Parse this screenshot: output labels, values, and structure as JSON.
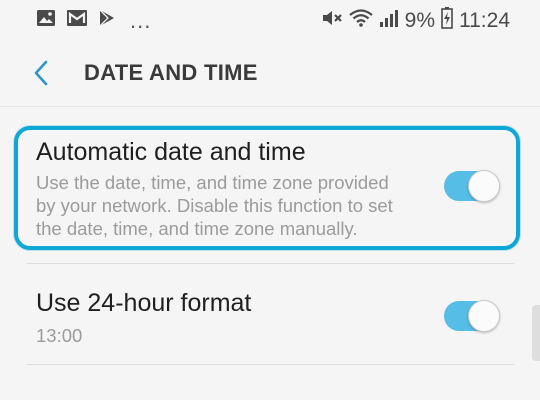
{
  "status_bar": {
    "battery_percent": "9%",
    "time": "11:24",
    "icons": [
      "gallery-icon",
      "mail-icon",
      "play-store-icon",
      "more-notifications-icon",
      "mute-icon",
      "wifi-icon",
      "signal-icon",
      "battery-icon"
    ]
  },
  "header": {
    "title": "DATE AND TIME"
  },
  "settings": {
    "automatic": {
      "title": "Automatic date and time",
      "subtitle_lines": [
        "Use the date, time, and time zone provided",
        "by your network. Disable this function to set",
        "the date, time, and time zone manually."
      ],
      "enabled": true
    },
    "hour24": {
      "title": "Use 24-hour format",
      "subtitle": "13:00",
      "enabled": true
    }
  },
  "colors": {
    "accent": "#0fa6d8",
    "toggle_on": "#55bde6",
    "background": "#f5f5f5"
  }
}
